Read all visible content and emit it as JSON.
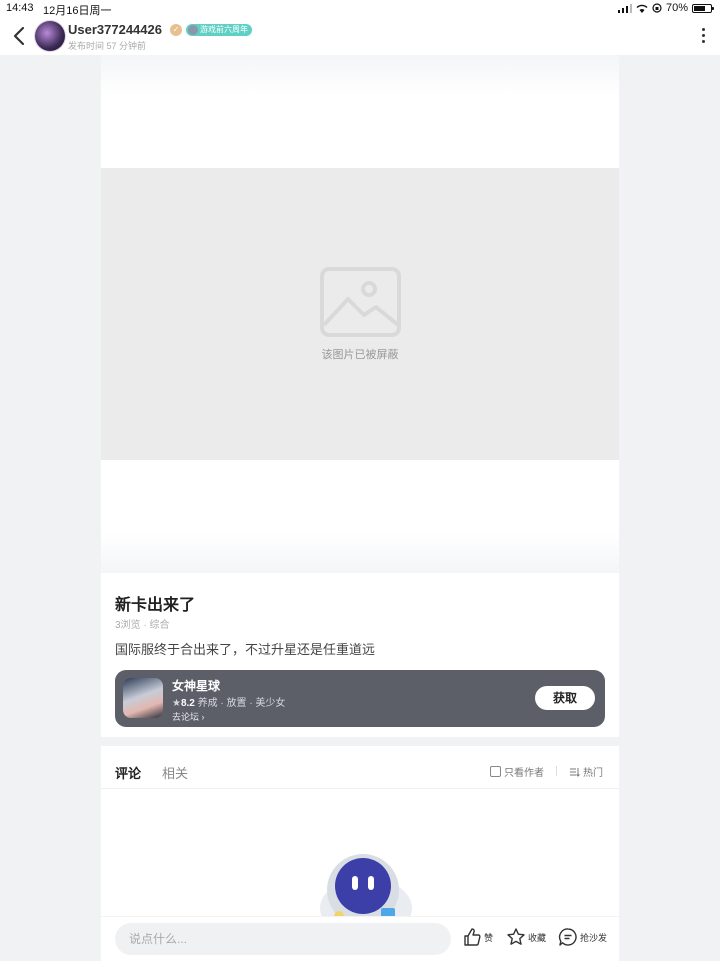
{
  "status_bar": {
    "time": "14:43",
    "date": "12月16日周一",
    "battery": "70%",
    "battery_level": 0.7
  },
  "header": {
    "username": "User377244426",
    "badge_anniversary": "游戏前六周年",
    "post_time": "发布时间 57 分钟前"
  },
  "image_block": {
    "blocked_text": "该图片已被屏蔽"
  },
  "post": {
    "title": "新卡出来了",
    "meta": "3浏览 · 综合",
    "body": "国际服终于合出来了，不过升星还是任重道远"
  },
  "game": {
    "name": "女神星球",
    "score": "8.2",
    "tags": "养成 · 放置 · 美少女",
    "forum_link": "去论坛",
    "get_label": "获取"
  },
  "comments": {
    "tabs": [
      "评论",
      "相关"
    ],
    "only_author": "只看作者",
    "sort": "热门"
  },
  "bottom_bar": {
    "placeholder": "说点什么...",
    "like": "赞",
    "favorite": "收藏",
    "sofa": "抢沙发"
  }
}
